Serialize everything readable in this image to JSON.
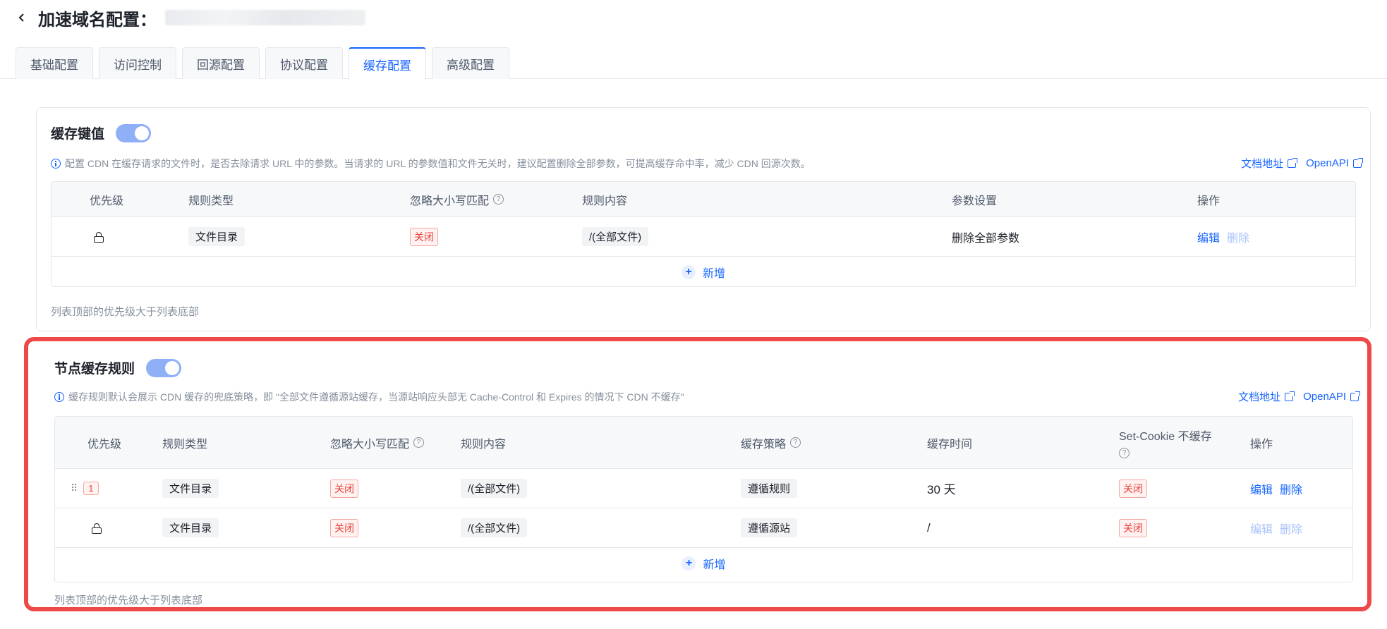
{
  "header": {
    "title": "加速域名配置："
  },
  "tabs": [
    "基础配置",
    "访问控制",
    "回源配置",
    "协议配置",
    "缓存配置",
    "高级配置"
  ],
  "active_tab": "缓存配置",
  "cache_key": {
    "title": "缓存键值",
    "enabled": true,
    "description": "配置 CDN 在缓存请求的文件时，是否去除请求 URL 中的参数。当请求的 URL 的参数值和文件无关时，建议配置删除全部参数，可提高缓存命中率，减少 CDN 回源次数。",
    "doc_link": "文档地址",
    "api_link": "OpenAPI",
    "columns": [
      "优先级",
      "规则类型",
      "忽略大小写匹配",
      "规则内容",
      "参数设置",
      "操作"
    ],
    "rows": [
      {
        "rule_type": "文件目录",
        "ignore_case": "关闭",
        "content": "/(全部文件)",
        "param": "删除全部参数",
        "edit": "编辑",
        "delete": "删除"
      }
    ],
    "add_label": "新增",
    "footnote": "列表顶部的优先级大于列表底部"
  },
  "node_cache": {
    "title": "节点缓存规则",
    "enabled": true,
    "description": "缓存规则默认会展示 CDN 缓存的兜底策略，即 \"全部文件遵循源站缓存，当源站响应头部无 Cache-Control 和 Expires 的情况下 CDN 不缓存\"",
    "doc_link": "文档地址",
    "api_link": "OpenAPI",
    "columns": [
      "优先级",
      "规则类型",
      "忽略大小写匹配",
      "规则内容",
      "缓存策略",
      "缓存时间",
      "Set-Cookie 不缓存",
      "操作"
    ],
    "rows": [
      {
        "priority": "1",
        "rule_type": "文件目录",
        "ignore_case": "关闭",
        "content": "/(全部文件)",
        "policy": "遵循规则",
        "time": "30 天",
        "set_cookie": "关闭",
        "edit": "编辑",
        "delete": "删除"
      },
      {
        "priority": "",
        "rule_type": "文件目录",
        "ignore_case": "关闭",
        "content": "/(全部文件)",
        "policy": "遵循源站",
        "time": "/",
        "set_cookie": "关闭",
        "edit": "编辑",
        "delete": "删除"
      }
    ],
    "add_label": "新增",
    "footnote": "列表顶部的优先级大于列表底部"
  }
}
